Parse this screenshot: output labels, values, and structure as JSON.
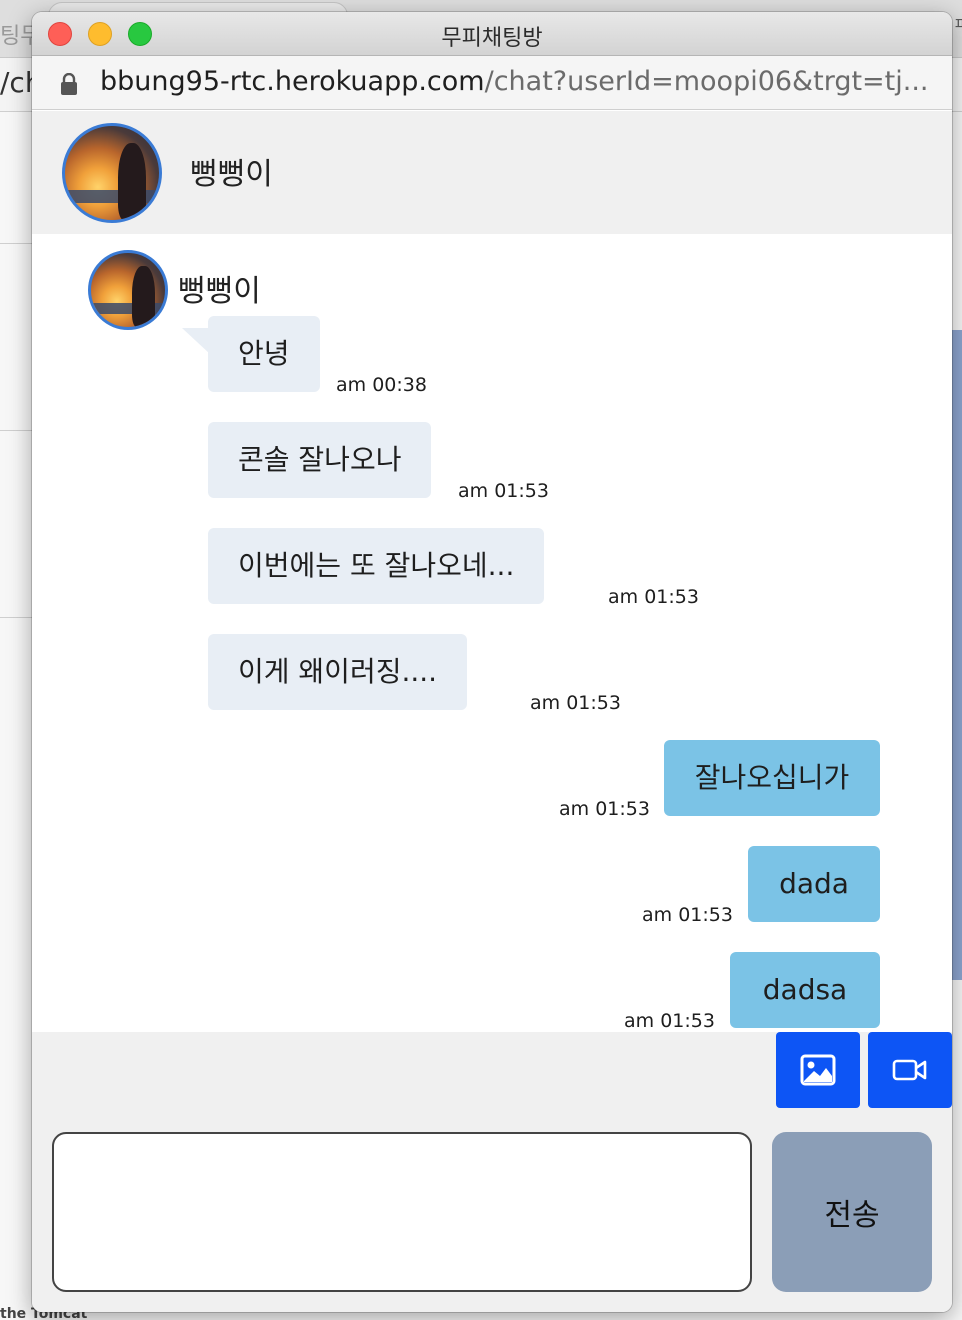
{
  "background": {
    "left_title_fragment": "팅무",
    "left_url_fragment": "/ch",
    "bottom_text_fragment": "the Tomcat"
  },
  "window": {
    "title": "무피채팅방",
    "url_host": "bbung95-rtc.herokuapp.com",
    "url_path": "/chat?userId=moopi06&trgt=tj..."
  },
  "chat_header": {
    "partner_name": "뻥뻥이",
    "avatar_icon": "profile-photo-sunset"
  },
  "messages": {
    "sender_name": "뻥뻥이",
    "items": [
      {
        "direction": "in",
        "text": "안녕",
        "time": "am 00:38"
      },
      {
        "direction": "in",
        "text": "콘솔 잘나오나",
        "time": "am 01:53"
      },
      {
        "direction": "in",
        "text": "이번에는 또 잘나오네...",
        "time": "am 01:53"
      },
      {
        "direction": "in",
        "text": "이게 왜이러징....",
        "time": "am 01:53"
      },
      {
        "direction": "out",
        "text": "잘나오십니가",
        "time": "am 01:53"
      },
      {
        "direction": "out",
        "text": "dada",
        "time": "am 01:53"
      },
      {
        "direction": "out",
        "text": "dadsa",
        "time": "am 01:53"
      }
    ]
  },
  "toolbar": {
    "image_icon": "image-icon",
    "video_icon": "video-camera-icon"
  },
  "composer": {
    "input_value": "",
    "send_label": "전송"
  },
  "colors": {
    "incoming_bubble": "#e8eef5",
    "outgoing_bubble": "#7bc3e6",
    "tool_button": "#0d55f5",
    "send_button": "#8b9eb7",
    "avatar_border": "#3a7bd5"
  }
}
